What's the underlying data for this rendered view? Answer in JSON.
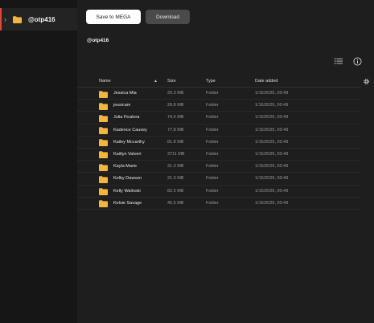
{
  "sidebar": {
    "items": [
      {
        "label": "@otp416",
        "icon": "folder-icon",
        "selected": true
      }
    ]
  },
  "toolbar": {
    "save_label": "Save to MEGA",
    "download_label": "Download"
  },
  "folder": {
    "title": "@otp416"
  },
  "colors": {
    "accent": "#e3453b",
    "folder": "#f2b53f",
    "background": "#1e1e1e",
    "sidebar": "#161616"
  },
  "table": {
    "columns": [
      {
        "key": "name",
        "label": "Name",
        "sorted": "ascending"
      },
      {
        "key": "size",
        "label": "Size"
      },
      {
        "key": "type",
        "label": "Type"
      },
      {
        "key": "date",
        "label": "Date added"
      }
    ],
    "rows": [
      {
        "name": "Jessica Mia",
        "size": "20.3 MB",
        "type": "Folder",
        "date": "1/16/2025, 00:49"
      },
      {
        "name": "jessicam",
        "size": "28.8 MB",
        "type": "Folder",
        "date": "1/16/2025, 00:49"
      },
      {
        "name": "Julia Ficalora",
        "size": "74.4 MB",
        "type": "Folder",
        "date": "1/16/2025, 00:49"
      },
      {
        "name": "Kadence Causey",
        "size": "77.8 MB",
        "type": "Folder",
        "date": "1/16/2025, 00:49"
      },
      {
        "name": "Kailey Mccarthy",
        "size": "81.8 MB",
        "type": "Folder",
        "date": "1/16/2025, 00:49"
      },
      {
        "name": "Kaitlyn Valveri",
        "size": "3711 MB",
        "type": "Folder",
        "date": "1/16/2025, 00:49"
      },
      {
        "name": "Kayla Marie",
        "size": "31.3 MB",
        "type": "Folder",
        "date": "1/16/2025, 00:49"
      },
      {
        "name": "Kelby Dawson",
        "size": "21.0 MB",
        "type": "Folder",
        "date": "1/16/2025, 00:49"
      },
      {
        "name": "Kelly Walinski",
        "size": "82.5 MB",
        "type": "Folder",
        "date": "1/16/2025, 00:49"
      },
      {
        "name": "Kelsie Savage",
        "size": "45.5 MB",
        "type": "Folder",
        "date": "1/16/2025, 00:49"
      }
    ]
  }
}
